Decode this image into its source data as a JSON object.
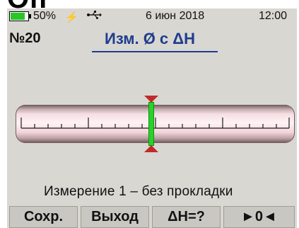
{
  "top_clip": {
    "text": "Оп"
  },
  "status_bar": {
    "battery_percent": "50%",
    "battery_level": 0.5,
    "icons": [
      "battery-icon",
      "lightning-icon",
      "usb-icon"
    ],
    "date": "6 июн 2018",
    "time": "12:00"
  },
  "header": {
    "measurement_number": "№20",
    "mode_title": "Изм. Ø с ΔH"
  },
  "scale": {
    "marker_position": 0.5
  },
  "message": {
    "text": "Измерение 1 – без прокладки"
  },
  "buttons": [
    {
      "label": "Сохр."
    },
    {
      "label": "Выход"
    },
    {
      "label": "ΔH=?"
    },
    {
      "label": "►0◄"
    }
  ],
  "colors": {
    "screen_bg": "#d9d7d2",
    "title_blue": "#1f3d8f",
    "marker_green": "#2ad12a",
    "marker_red": "#c22a2a",
    "battery_green": "#28c628"
  }
}
